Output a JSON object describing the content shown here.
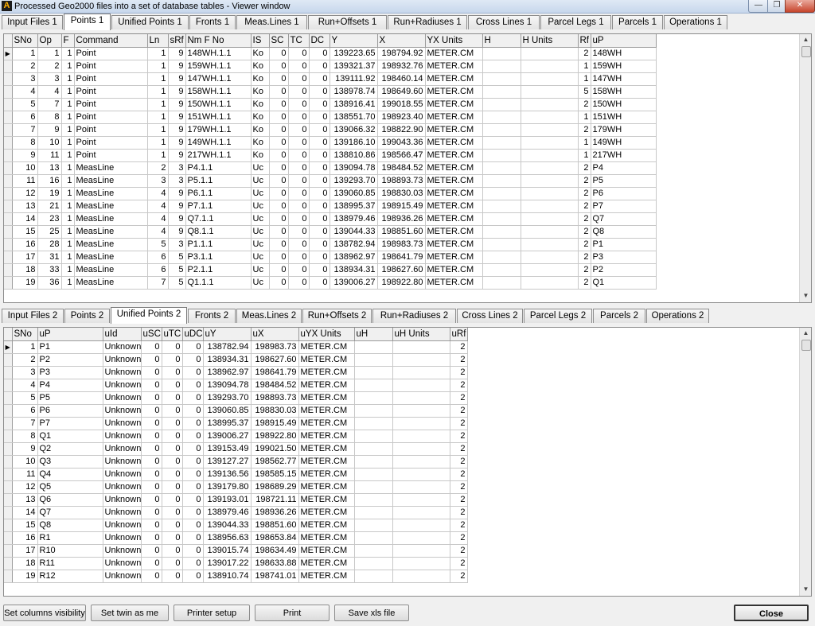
{
  "window": {
    "title": "Processed Geo2000 files into a set of database tables - Viewer window",
    "min_glyph": "—",
    "max_glyph": "❐",
    "close_glyph": "✕",
    "app_icon_glyph": "A"
  },
  "top_tabs": [
    "Input Files 1",
    "Points 1",
    "Unified Points 1",
    "Fronts 1",
    "Meas.Lines 1",
    "Run+Offsets 1",
    "Run+Radiuses 1",
    "Cross Lines 1",
    "Parcel Legs 1",
    "Parcels 1",
    "Operations 1"
  ],
  "top_active_tab": "Points 1",
  "top_grid": {
    "columns": [
      "SNo",
      "Op",
      "F",
      "Command",
      "Ln",
      "sRf",
      "Nm F No",
      "IS",
      "SC",
      "TC",
      "DC",
      "Y",
      "X",
      "YX Units",
      "H",
      "H Units",
      "Rf",
      "uP"
    ],
    "rows": [
      [
        "1",
        "1",
        "1",
        "Point",
        "1",
        "9",
        "148WH.1.1",
        "Ko",
        "0",
        "0",
        "0",
        "139223.65",
        "198794.92",
        "METER.CM",
        "",
        "",
        "2",
        "148WH"
      ],
      [
        "2",
        "2",
        "1",
        "Point",
        "1",
        "9",
        "159WH.1.1",
        "Ko",
        "0",
        "0",
        "0",
        "139321.37",
        "198932.76",
        "METER.CM",
        "",
        "",
        "1",
        "159WH"
      ],
      [
        "3",
        "3",
        "1",
        "Point",
        "1",
        "9",
        "147WH.1.1",
        "Ko",
        "0",
        "0",
        "0",
        "139111.92",
        "198460.14",
        "METER.CM",
        "",
        "",
        "1",
        "147WH"
      ],
      [
        "4",
        "4",
        "1",
        "Point",
        "1",
        "9",
        "158WH.1.1",
        "Ko",
        "0",
        "0",
        "0",
        "138978.74",
        "198649.60",
        "METER.CM",
        "",
        "",
        "5",
        "158WH"
      ],
      [
        "5",
        "7",
        "1",
        "Point",
        "1",
        "9",
        "150WH.1.1",
        "Ko",
        "0",
        "0",
        "0",
        "138916.41",
        "199018.55",
        "METER.CM",
        "",
        "",
        "2",
        "150WH"
      ],
      [
        "6",
        "8",
        "1",
        "Point",
        "1",
        "9",
        "151WH.1.1",
        "Ko",
        "0",
        "0",
        "0",
        "138551.70",
        "198923.40",
        "METER.CM",
        "",
        "",
        "1",
        "151WH"
      ],
      [
        "7",
        "9",
        "1",
        "Point",
        "1",
        "9",
        "179WH.1.1",
        "Ko",
        "0",
        "0",
        "0",
        "139066.32",
        "198822.90",
        "METER.CM",
        "",
        "",
        "2",
        "179WH"
      ],
      [
        "8",
        "10",
        "1",
        "Point",
        "1",
        "9",
        "149WH.1.1",
        "Ko",
        "0",
        "0",
        "0",
        "139186.10",
        "199043.36",
        "METER.CM",
        "",
        "",
        "1",
        "149WH"
      ],
      [
        "9",
        "11",
        "1",
        "Point",
        "1",
        "9",
        "217WH.1.1",
        "Ko",
        "0",
        "0",
        "0",
        "138810.86",
        "198566.47",
        "METER.CM",
        "",
        "",
        "1",
        "217WH"
      ],
      [
        "10",
        "13",
        "1",
        "MeasLine",
        "2",
        "3",
        "P4.1.1",
        "Uc",
        "0",
        "0",
        "0",
        "139094.78",
        "198484.52",
        "METER.CM",
        "",
        "",
        "2",
        "P4"
      ],
      [
        "11",
        "16",
        "1",
        "MeasLine",
        "3",
        "3",
        "P5.1.1",
        "Uc",
        "0",
        "0",
        "0",
        "139293.70",
        "198893.73",
        "METER.CM",
        "",
        "",
        "2",
        "P5"
      ],
      [
        "12",
        "19",
        "1",
        "MeasLine",
        "4",
        "9",
        "P6.1.1",
        "Uc",
        "0",
        "0",
        "0",
        "139060.85",
        "198830.03",
        "METER.CM",
        "",
        "",
        "2",
        "P6"
      ],
      [
        "13",
        "21",
        "1",
        "MeasLine",
        "4",
        "9",
        "P7.1.1",
        "Uc",
        "0",
        "0",
        "0",
        "138995.37",
        "198915.49",
        "METER.CM",
        "",
        "",
        "2",
        "P7"
      ],
      [
        "14",
        "23",
        "1",
        "MeasLine",
        "4",
        "9",
        "Q7.1.1",
        "Uc",
        "0",
        "0",
        "0",
        "138979.46",
        "198936.26",
        "METER.CM",
        "",
        "",
        "2",
        "Q7"
      ],
      [
        "15",
        "25",
        "1",
        "MeasLine",
        "4",
        "9",
        "Q8.1.1",
        "Uc",
        "0",
        "0",
        "0",
        "139044.33",
        "198851.60",
        "METER.CM",
        "",
        "",
        "2",
        "Q8"
      ],
      [
        "16",
        "28",
        "1",
        "MeasLine",
        "5",
        "3",
        "P1.1.1",
        "Uc",
        "0",
        "0",
        "0",
        "138782.94",
        "198983.73",
        "METER.CM",
        "",
        "",
        "2",
        "P1"
      ],
      [
        "17",
        "31",
        "1",
        "MeasLine",
        "6",
        "5",
        "P3.1.1",
        "Uc",
        "0",
        "0",
        "0",
        "138962.97",
        "198641.79",
        "METER.CM",
        "",
        "",
        "2",
        "P3"
      ],
      [
        "18",
        "33",
        "1",
        "MeasLine",
        "6",
        "5",
        "P2.1.1",
        "Uc",
        "0",
        "0",
        "0",
        "138934.31",
        "198627.60",
        "METER.CM",
        "",
        "",
        "2",
        "P2"
      ],
      [
        "19",
        "36",
        "1",
        "MeasLine",
        "7",
        "5",
        "Q1.1.1",
        "Uc",
        "0",
        "0",
        "0",
        "139006.27",
        "198922.80",
        "METER.CM",
        "",
        "",
        "2",
        "Q1"
      ]
    ]
  },
  "bottom_tabs": [
    "Input Files 2",
    "Points 2",
    "Unified Points 2",
    "Fronts 2",
    "Meas.Lines 2",
    "Run+Offsets 2",
    "Run+Radiuses 2",
    "Cross Lines 2",
    "Parcel Legs 2",
    "Parcels 2",
    "Operations 2"
  ],
  "bottom_active_tab": "Unified Points 2",
  "bottom_grid": {
    "columns": [
      "SNo",
      "uP",
      "uId",
      "uSC",
      "uTC",
      "uDC",
      "uY",
      "uX",
      "uYX Units",
      "uH",
      "uH Units",
      "uRf"
    ],
    "rows": [
      [
        "1",
        "P1",
        "Unknown",
        "0",
        "0",
        "0",
        "138782.94",
        "198983.73",
        "METER.CM",
        "",
        "",
        "2"
      ],
      [
        "2",
        "P2",
        "Unknown",
        "0",
        "0",
        "0",
        "138934.31",
        "198627.60",
        "METER.CM",
        "",
        "",
        "2"
      ],
      [
        "3",
        "P3",
        "Unknown",
        "0",
        "0",
        "0",
        "138962.97",
        "198641.79",
        "METER.CM",
        "",
        "",
        "2"
      ],
      [
        "4",
        "P4",
        "Unknown",
        "0",
        "0",
        "0",
        "139094.78",
        "198484.52",
        "METER.CM",
        "",
        "",
        "2"
      ],
      [
        "5",
        "P5",
        "Unknown",
        "0",
        "0",
        "0",
        "139293.70",
        "198893.73",
        "METER.CM",
        "",
        "",
        "2"
      ],
      [
        "6",
        "P6",
        "Unknown",
        "0",
        "0",
        "0",
        "139060.85",
        "198830.03",
        "METER.CM",
        "",
        "",
        "2"
      ],
      [
        "7",
        "P7",
        "Unknown",
        "0",
        "0",
        "0",
        "138995.37",
        "198915.49",
        "METER.CM",
        "",
        "",
        "2"
      ],
      [
        "8",
        "Q1",
        "Unknown",
        "0",
        "0",
        "0",
        "139006.27",
        "198922.80",
        "METER.CM",
        "",
        "",
        "2"
      ],
      [
        "9",
        "Q2",
        "Unknown",
        "0",
        "0",
        "0",
        "139153.49",
        "199021.50",
        "METER.CM",
        "",
        "",
        "2"
      ],
      [
        "10",
        "Q3",
        "Unknown",
        "0",
        "0",
        "0",
        "139127.27",
        "198562.77",
        "METER.CM",
        "",
        "",
        "2"
      ],
      [
        "11",
        "Q4",
        "Unknown",
        "0",
        "0",
        "0",
        "139136.56",
        "198585.15",
        "METER.CM",
        "",
        "",
        "2"
      ],
      [
        "12",
        "Q5",
        "Unknown",
        "0",
        "0",
        "0",
        "139179.80",
        "198689.29",
        "METER.CM",
        "",
        "",
        "2"
      ],
      [
        "13",
        "Q6",
        "Unknown",
        "0",
        "0",
        "0",
        "139193.01",
        "198721.11",
        "METER.CM",
        "",
        "",
        "2"
      ],
      [
        "14",
        "Q7",
        "Unknown",
        "0",
        "0",
        "0",
        "138979.46",
        "198936.26",
        "METER.CM",
        "",
        "",
        "2"
      ],
      [
        "15",
        "Q8",
        "Unknown",
        "0",
        "0",
        "0",
        "139044.33",
        "198851.60",
        "METER.CM",
        "",
        "",
        "2"
      ],
      [
        "16",
        "R1",
        "Unknown",
        "0",
        "0",
        "0",
        "138956.63",
        "198653.84",
        "METER.CM",
        "",
        "",
        "2"
      ],
      [
        "17",
        "R10",
        "Unknown",
        "0",
        "0",
        "0",
        "139015.74",
        "198634.49",
        "METER.CM",
        "",
        "",
        "2"
      ],
      [
        "18",
        "R11",
        "Unknown",
        "0",
        "0",
        "0",
        "139017.22",
        "198633.88",
        "METER.CM",
        "",
        "",
        "2"
      ],
      [
        "19",
        "R12",
        "Unknown",
        "0",
        "0",
        "0",
        "138910.74",
        "198741.01",
        "METER.CM",
        "",
        "",
        "2"
      ]
    ]
  },
  "buttons": {
    "columns_visibility": "Set columns visibility",
    "twin": "Set twin as me",
    "printer_setup": "Printer setup",
    "print": "Print",
    "save_xls": "Save xls file",
    "close": "Close"
  },
  "scroll_glyphs": {
    "up": "▲",
    "down": "▼"
  },
  "current_row_glyph": "▶"
}
